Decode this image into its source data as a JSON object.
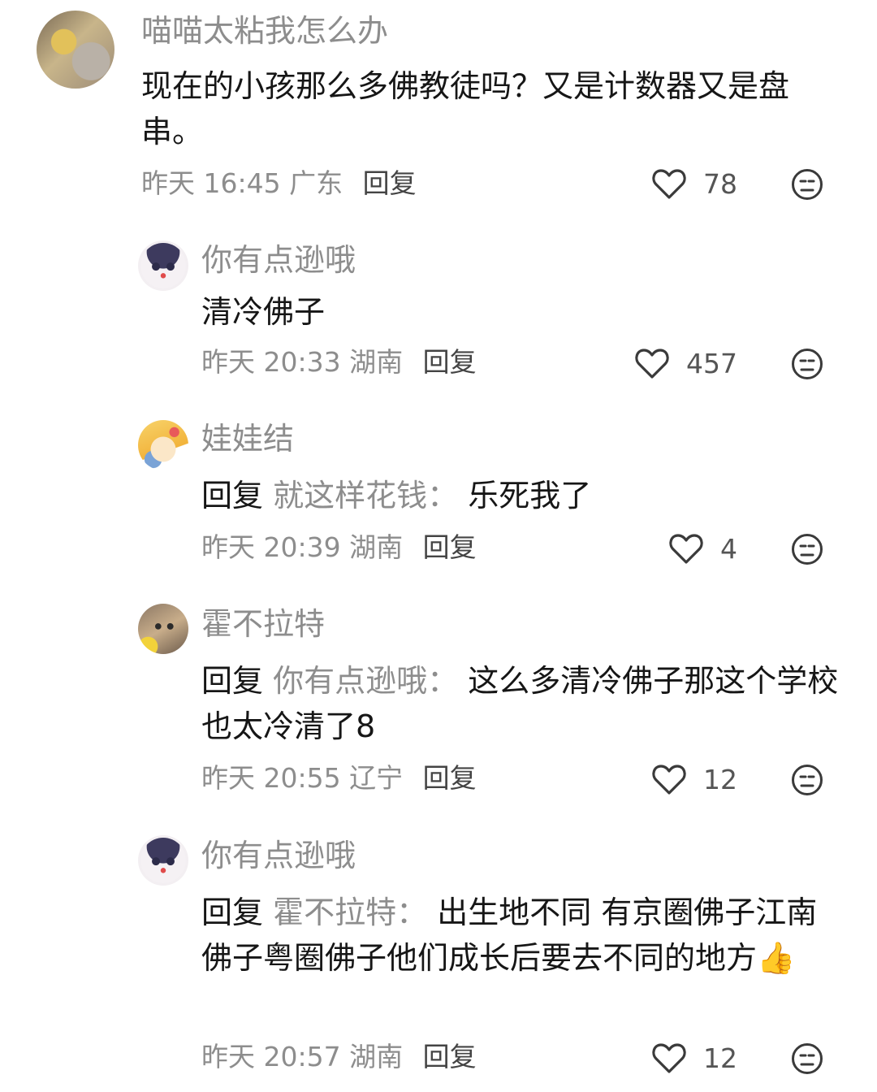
{
  "comments": [
    {
      "name": "喵喵太粘我怎么办",
      "text": "现在的小孩那么多佛教徒吗？又是计数器又是盘串。",
      "time": "昨天 16:45",
      "location": "广东",
      "reply_label": "回复",
      "likes": "78"
    },
    {
      "name": "你有点逊哦",
      "text": "清冷佛子",
      "time": "昨天 20:33",
      "location": "湖南",
      "reply_label": "回复",
      "likes": "457"
    },
    {
      "name": "娃娃结",
      "reply_prefix": "回复",
      "reply_target": "就这样花钱：",
      "text": "乐死我了",
      "time": "昨天 20:39",
      "location": "湖南",
      "reply_label": "回复",
      "likes": "4"
    },
    {
      "name": "霍不拉特",
      "reply_prefix": "回复",
      "reply_target": "你有点逊哦：",
      "text": "这么多清冷佛子那这个学校也太冷清了8",
      "time": "昨天 20:55",
      "location": "辽宁",
      "reply_label": "回复",
      "likes": "12"
    },
    {
      "name": "你有点逊哦",
      "reply_prefix": "回复",
      "reply_target": "霍不拉特：",
      "text": "出生地不同 有京圈佛子江南佛子粤圈佛子他们成长后要去不同的地方",
      "emoji": "👍",
      "time": "昨天 20:57",
      "location": "湖南",
      "reply_label": "回复",
      "likes": "12"
    }
  ],
  "icons": {
    "like": "heart-outline-icon",
    "dislike": "unimpressed-face-icon"
  },
  "colors": {
    "name": "#8d8d8d",
    "text": "#161616",
    "meta": "#8d8d8d"
  }
}
